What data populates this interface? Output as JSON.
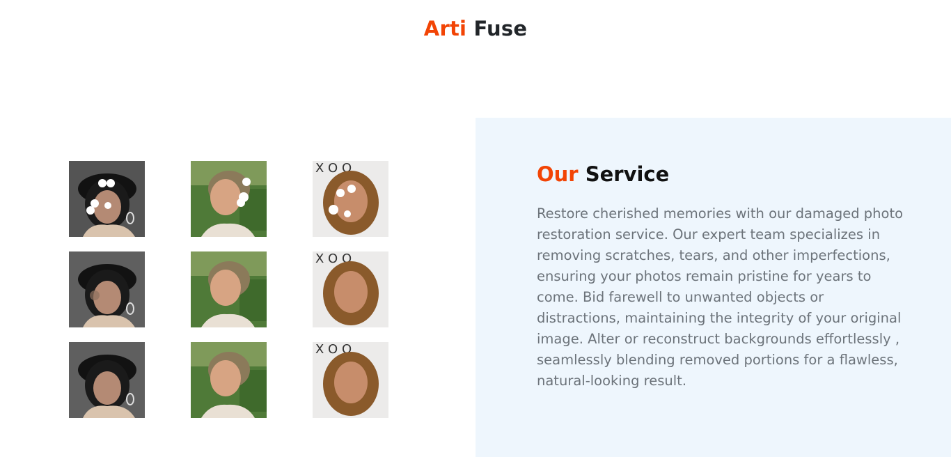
{
  "brand": {
    "first": "Arti",
    "second": "Fuse"
  },
  "colors": {
    "accent": "#f24405",
    "dark": "#212529",
    "panel": "#eef6fd",
    "body_text": "#6c737a"
  },
  "gallery": {
    "rows": [
      {
        "kind": "damaged",
        "images": [
          "woman-in-black-hat",
          "older-woman-outdoors",
          "young-woman-long-hair"
        ]
      },
      {
        "kind": "masked-inpainting",
        "images": [
          "woman-in-black-hat",
          "older-woman-outdoors",
          "young-woman-long-hair"
        ]
      },
      {
        "kind": "restored",
        "images": [
          "woman-in-black-hat",
          "older-woman-outdoors",
          "young-woman-long-hair"
        ]
      }
    ]
  },
  "service": {
    "title_accent": "Our",
    "title_rest": "Service",
    "description": "Restore cherished memories with our damaged photo restoration service. Our expert team specializes in removing scratches, tears, and other imperfections, ensuring your photos remain pristine for years to come. Bid farewell to unwanted objects or distractions, maintaining the integrity of your original image. Alter or reconstruct backgrounds effortlessly , seamlessly blending removed portions for a flawless, natural-looking result."
  }
}
